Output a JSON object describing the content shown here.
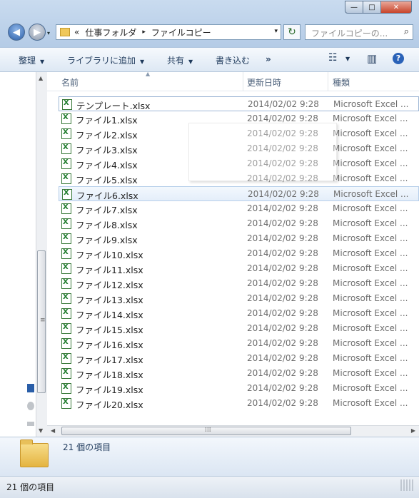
{
  "window": {
    "caption_buttons": {
      "minimize": "—",
      "maximize": "□",
      "close": "✕"
    }
  },
  "nav": {
    "back_icon": "◀",
    "forward_icon": "▶",
    "dropdown_icon": "▾"
  },
  "address": {
    "overflow": "«",
    "crumbs": [
      "仕事フォルダ",
      "ファイルコピー"
    ],
    "separator": "▸",
    "dropdown_icon": "▾"
  },
  "refresh_icon": "↻",
  "search": {
    "placeholder": "ファイルコピーの..."
  },
  "toolbar": {
    "organize": "整理",
    "add_library": "ライブラリに追加",
    "share": "共有",
    "burn": "書き込む",
    "more": "»",
    "view_icon": "☷",
    "preview_icon": "▥",
    "help_icon": "?"
  },
  "columns": {
    "name": "名前",
    "date": "更新日時",
    "type": "種類"
  },
  "files": [
    {
      "name": "テンプレート.xlsx",
      "date": "2014/02/02 9:28",
      "type": "Microsoft Excel ..."
    },
    {
      "name": "ファイル1.xlsx",
      "date": "2014/02/02 9:28",
      "type": "Microsoft Excel ..."
    },
    {
      "name": "ファイル2.xlsx",
      "date": "2014/02/02 9:28",
      "type": "Microsoft Excel ..."
    },
    {
      "name": "ファイル3.xlsx",
      "date": "2014/02/02 9:28",
      "type": "Microsoft Excel ..."
    },
    {
      "name": "ファイル4.xlsx",
      "date": "2014/02/02 9:28",
      "type": "Microsoft Excel ..."
    },
    {
      "name": "ファイル5.xlsx",
      "date": "2014/02/02 9:28",
      "type": "Microsoft Excel ..."
    },
    {
      "name": "ファイル6.xlsx",
      "date": "2014/02/02 9:28",
      "type": "Microsoft Excel ..."
    },
    {
      "name": "ファイル7.xlsx",
      "date": "2014/02/02 9:28",
      "type": "Microsoft Excel ..."
    },
    {
      "name": "ファイル8.xlsx",
      "date": "2014/02/02 9:28",
      "type": "Microsoft Excel ..."
    },
    {
      "name": "ファイル9.xlsx",
      "date": "2014/02/02 9:28",
      "type": "Microsoft Excel ..."
    },
    {
      "name": "ファイル10.xlsx",
      "date": "2014/02/02 9:28",
      "type": "Microsoft Excel ..."
    },
    {
      "name": "ファイル11.xlsx",
      "date": "2014/02/02 9:28",
      "type": "Microsoft Excel ..."
    },
    {
      "name": "ファイル12.xlsx",
      "date": "2014/02/02 9:28",
      "type": "Microsoft Excel ..."
    },
    {
      "name": "ファイル13.xlsx",
      "date": "2014/02/02 9:28",
      "type": "Microsoft Excel ..."
    },
    {
      "name": "ファイル14.xlsx",
      "date": "2014/02/02 9:28",
      "type": "Microsoft Excel ..."
    },
    {
      "name": "ファイル15.xlsx",
      "date": "2014/02/02 9:28",
      "type": "Microsoft Excel ..."
    },
    {
      "name": "ファイル16.xlsx",
      "date": "2014/02/02 9:28",
      "type": "Microsoft Excel ..."
    },
    {
      "name": "ファイル17.xlsx",
      "date": "2014/02/02 9:28",
      "type": "Microsoft Excel ..."
    },
    {
      "name": "ファイル18.xlsx",
      "date": "2014/02/02 9:28",
      "type": "Microsoft Excel ..."
    },
    {
      "name": "ファイル19.xlsx",
      "date": "2014/02/02 9:28",
      "type": "Microsoft Excel ..."
    },
    {
      "name": "ファイル20.xlsx",
      "date": "2014/02/02 9:28",
      "type": "Microsoft Excel ..."
    }
  ],
  "details": {
    "count": "21 個の項目"
  },
  "status": {
    "text": "21 個の項目"
  }
}
